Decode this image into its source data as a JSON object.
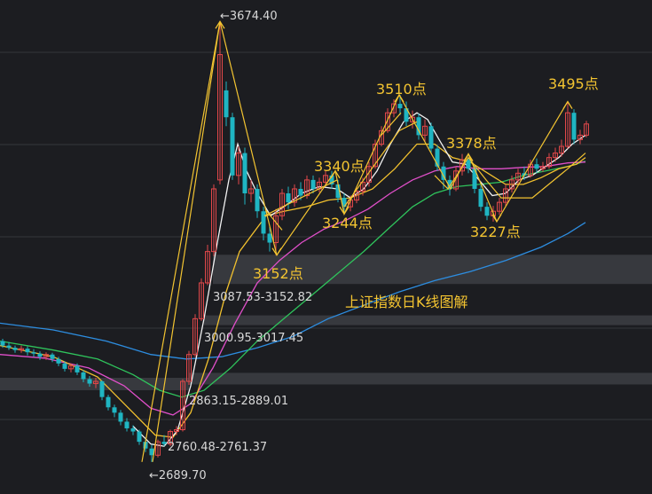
{
  "chart_data": {
    "type": "candlestick",
    "title": "上证指数日K线图解",
    "colors": {
      "background": "#1c1d21",
      "grid": "#34363b",
      "up": "#e2484a",
      "down": "#1fb5c2",
      "ma_white": "#f2f2f2",
      "ma_yellow": "#f2c12e",
      "ma_magenta": "#e04fc9",
      "ma_green": "#2fc45c",
      "ma_blue": "#2d8de0",
      "wave": "#f3c431",
      "band": "#3c3e43"
    },
    "price_annotations": [
      {
        "text": "←3674.40",
        "value": 3674.4
      },
      {
        "text": "3087.53-3152.82",
        "value": 3120
      },
      {
        "text": "3000.95-3017.45",
        "value": 3009
      },
      {
        "text": "2863.15-2889.01",
        "value": 2876
      },
      {
        "text": "2760.48-2761.37",
        "value": 2761
      },
      {
        "text": "←2689.70",
        "value": 2689.7
      }
    ],
    "gap_bands": [
      {
        "low": 3087.53,
        "high": 3152.82
      },
      {
        "low": 3000.95,
        "high": 3017.45
      },
      {
        "low": 2863.15,
        "high": 2889.01
      }
    ],
    "wave_labels": [
      {
        "text": "3152点",
        "value": 3152
      },
      {
        "text": "3340点",
        "value": 3340
      },
      {
        "text": "3244点",
        "value": 3244
      },
      {
        "text": "3510点",
        "value": 3510
      },
      {
        "text": "3378点",
        "value": 3378
      },
      {
        "text": "3227点",
        "value": 3227
      },
      {
        "text": "3495点",
        "value": 3495
      }
    ]
  }
}
